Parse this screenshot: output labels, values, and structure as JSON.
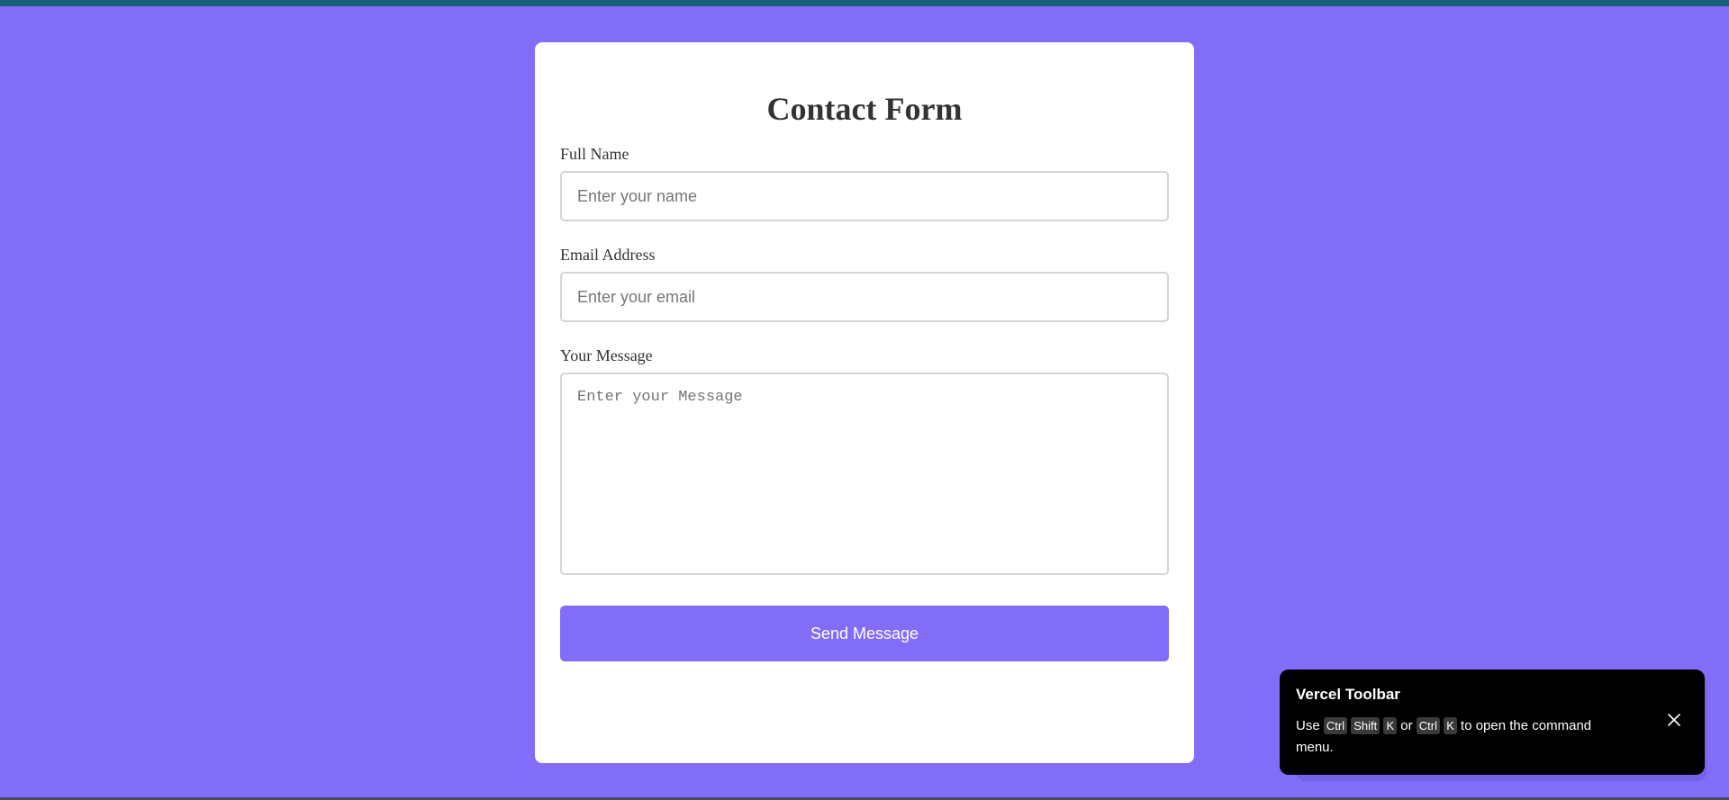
{
  "form": {
    "title": "Contact Form",
    "name_label": "Full Name",
    "name_placeholder": "Enter your name",
    "email_label": "Email Address",
    "email_placeholder": "Enter your email",
    "message_label": "Your Message",
    "message_placeholder": "Enter your Message",
    "submit_label": "Send Message"
  },
  "vercel_toolbar": {
    "title": "Vercel Toolbar",
    "text_use": "Use",
    "key_ctrl_1": "Ctrl",
    "key_shift": "Shift",
    "key_k_1": "K",
    "text_or": "or",
    "key_ctrl_2": "Ctrl",
    "key_k_2": "K",
    "text_tail": "to open the command menu.",
    "close_icon": "close-icon"
  },
  "colors": {
    "page_background": "#826df9",
    "accent": "#826df9",
    "card_background": "#ffffff",
    "toolbar_background": "#000000",
    "top_strip": "#17607a"
  }
}
